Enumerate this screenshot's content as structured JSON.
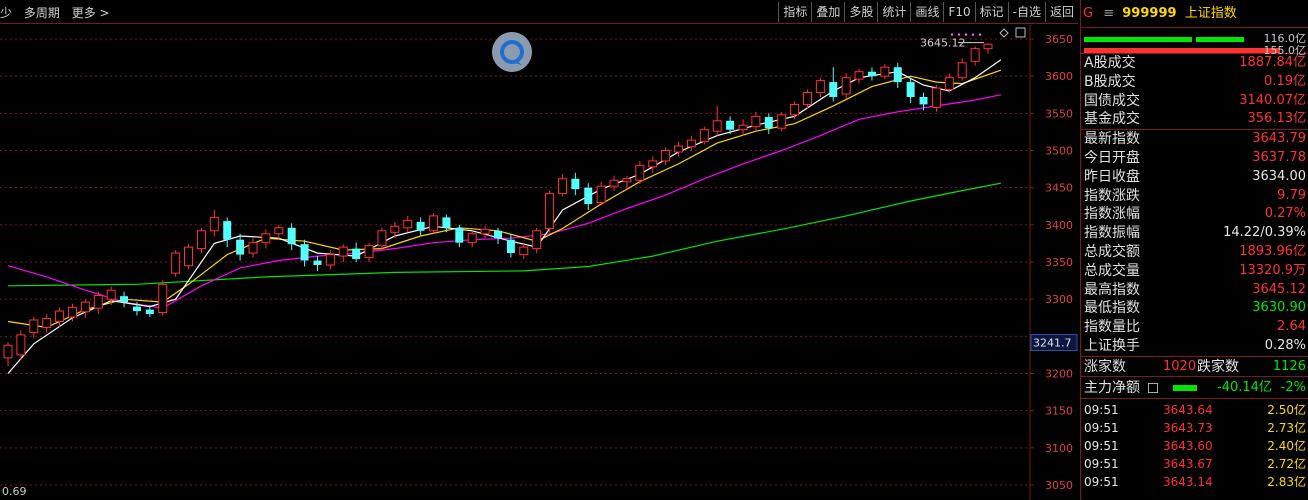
{
  "toolbar": {
    "left_items": [
      "少",
      "多周期",
      "更多 >"
    ],
    "buttons": [
      "指标",
      "叠加",
      "多股",
      "统计",
      "画线",
      "F10",
      "标记",
      "-自选",
      "返回"
    ]
  },
  "chart": {
    "price_axis": [
      "3650",
      "3600",
      "3550",
      "3500",
      "3450",
      "3400",
      "3350",
      "3300",
      "3241.7",
      "3200",
      "3150",
      "3100",
      "3050"
    ],
    "high_label": "3645.12",
    "bottom_left_value": "0.69",
    "colors": {
      "up": "#ff3232",
      "down": "#54ffff",
      "ma5": "#ffffff",
      "ma10": "#ffd800",
      "ma20": "#ff00ff",
      "ma60": "#00e600",
      "grid": "#7a1a1a"
    },
    "icon": "chat-bubble-icon"
  },
  "chart_data": {
    "type": "candlestick",
    "ylim": [
      3050,
      3660
    ],
    "candles": [
      [
        3221,
        3238,
        3210,
        3242
      ],
      [
        3225,
        3252,
        3218,
        3258
      ],
      [
        3255,
        3272,
        3248,
        3276
      ],
      [
        3262,
        3274,
        3255,
        3280
      ],
      [
        3270,
        3284,
        3262,
        3289
      ],
      [
        3276,
        3289,
        3270,
        3294
      ],
      [
        3283,
        3296,
        3275,
        3300
      ],
      [
        3288,
        3305,
        3280,
        3310
      ],
      [
        3300,
        3312,
        3292,
        3317
      ],
      [
        3304,
        3296,
        3289,
        3310
      ],
      [
        3290,
        3284,
        3278,
        3296
      ],
      [
        3286,
        3280,
        3276,
        3292
      ],
      [
        3282,
        3320,
        3278,
        3326
      ],
      [
        3335,
        3362,
        3330,
        3366
      ],
      [
        3345,
        3370,
        3340,
        3374
      ],
      [
        3368,
        3392,
        3362,
        3396
      ],
      [
        3392,
        3410,
        3385,
        3420
      ],
      [
        3405,
        3380,
        3370,
        3410
      ],
      [
        3380,
        3360,
        3352,
        3388
      ],
      [
        3362,
        3376,
        3356,
        3382
      ],
      [
        3376,
        3388,
        3368,
        3394
      ],
      [
        3388,
        3396,
        3380,
        3400
      ],
      [
        3396,
        3374,
        3366,
        3402
      ],
      [
        3374,
        3352,
        3344,
        3380
      ],
      [
        3352,
        3346,
        3338,
        3358
      ],
      [
        3346,
        3360,
        3340,
        3366
      ],
      [
        3358,
        3370,
        3350,
        3374
      ],
      [
        3368,
        3354,
        3350,
        3376
      ],
      [
        3356,
        3372,
        3350,
        3376
      ],
      [
        3372,
        3392,
        3366,
        3396
      ],
      [
        3390,
        3398,
        3382,
        3404
      ],
      [
        3396,
        3406,
        3390,
        3412
      ],
      [
        3404,
        3392,
        3386,
        3410
      ],
      [
        3392,
        3412,
        3388,
        3416
      ],
      [
        3410,
        3396,
        3390,
        3414
      ],
      [
        3396,
        3376,
        3370,
        3400
      ],
      [
        3376,
        3388,
        3370,
        3392
      ],
      [
        3388,
        3394,
        3382,
        3398
      ],
      [
        3392,
        3382,
        3374,
        3396
      ],
      [
        3380,
        3362,
        3356,
        3388
      ],
      [
        3360,
        3370,
        3354,
        3376
      ],
      [
        3368,
        3392,
        3362,
        3396
      ],
      [
        3395,
        3442,
        3390,
        3446
      ],
      [
        3442,
        3462,
        3438,
        3468
      ],
      [
        3462,
        3448,
        3440,
        3470
      ],
      [
        3450,
        3428,
        3420,
        3456
      ],
      [
        3430,
        3452,
        3426,
        3458
      ],
      [
        3452,
        3460,
        3446,
        3466
      ],
      [
        3458,
        3462,
        3450,
        3466
      ],
      [
        3460,
        3480,
        3455,
        3486
      ],
      [
        3478,
        3486,
        3470,
        3492
      ],
      [
        3486,
        3500,
        3480,
        3504
      ],
      [
        3498,
        3506,
        3492,
        3512
      ],
      [
        3505,
        3514,
        3500,
        3520
      ],
      [
        3512,
        3528,
        3508,
        3532
      ],
      [
        3526,
        3540,
        3520,
        3560
      ],
      [
        3540,
        3528,
        3522,
        3546
      ],
      [
        3528,
        3534,
        3520,
        3542
      ],
      [
        3532,
        3546,
        3526,
        3552
      ],
      [
        3545,
        3530,
        3522,
        3550
      ],
      [
        3530,
        3548,
        3526,
        3552
      ],
      [
        3548,
        3562,
        3542,
        3566
      ],
      [
        3562,
        3578,
        3556,
        3582
      ],
      [
        3578,
        3594,
        3572,
        3598
      ],
      [
        3592,
        3572,
        3566,
        3612
      ],
      [
        3576,
        3598,
        3570,
        3604
      ],
      [
        3596,
        3606,
        3590,
        3610
      ],
      [
        3606,
        3600,
        3594,
        3612
      ],
      [
        3600,
        3612,
        3596,
        3616
      ],
      [
        3612,
        3592,
        3584,
        3618
      ],
      [
        3592,
        3572,
        3564,
        3598
      ],
      [
        3572,
        3562,
        3554,
        3578
      ],
      [
        3558,
        3584,
        3552,
        3588
      ],
      [
        3582,
        3598,
        3578,
        3604
      ],
      [
        3598,
        3618,
        3594,
        3624
      ],
      [
        3620,
        3637,
        3614,
        3640
      ],
      [
        3637,
        3643,
        3630,
        3645
      ]
    ],
    "ma": {
      "ma5": {
        "color": "#ffffff",
        "points": [
          [
            0,
            3200
          ],
          [
            2,
            3240
          ],
          [
            5,
            3275
          ],
          [
            8,
            3298
          ],
          [
            11,
            3290
          ],
          [
            13,
            3300
          ],
          [
            16,
            3375
          ],
          [
            18,
            3385
          ],
          [
            21,
            3382
          ],
          [
            24,
            3362
          ],
          [
            27,
            3358
          ],
          [
            30,
            3385
          ],
          [
            33,
            3398
          ],
          [
            36,
            3392
          ],
          [
            39,
            3378
          ],
          [
            41,
            3370
          ],
          [
            43,
            3420
          ],
          [
            46,
            3448
          ],
          [
            49,
            3468
          ],
          [
            52,
            3498
          ],
          [
            55,
            3520
          ],
          [
            58,
            3534
          ],
          [
            61,
            3546
          ],
          [
            64,
            3580
          ],
          [
            66,
            3598
          ],
          [
            69,
            3606
          ],
          [
            71,
            3588
          ],
          [
            73,
            3580
          ],
          [
            75,
            3598
          ],
          [
            77,
            3622
          ]
        ]
      },
      "ma10": {
        "color": "#ffd800",
        "points": [
          [
            0,
            3270
          ],
          [
            3,
            3262
          ],
          [
            6,
            3286
          ],
          [
            9,
            3300
          ],
          [
            12,
            3296
          ],
          [
            14,
            3320
          ],
          [
            17,
            3360
          ],
          [
            20,
            3382
          ],
          [
            23,
            3378
          ],
          [
            26,
            3366
          ],
          [
            29,
            3368
          ],
          [
            32,
            3385
          ],
          [
            35,
            3396
          ],
          [
            38,
            3392
          ],
          [
            41,
            3378
          ],
          [
            43,
            3395
          ],
          [
            46,
            3428
          ],
          [
            49,
            3458
          ],
          [
            52,
            3482
          ],
          [
            55,
            3510
          ],
          [
            58,
            3526
          ],
          [
            61,
            3536
          ],
          [
            64,
            3560
          ],
          [
            67,
            3586
          ],
          [
            70,
            3600
          ],
          [
            72,
            3592
          ],
          [
            74,
            3590
          ],
          [
            77,
            3608
          ]
        ]
      },
      "ma20": {
        "color": "#ff00ff",
        "points": [
          [
            0,
            3345
          ],
          [
            3,
            3330
          ],
          [
            6,
            3312
          ],
          [
            9,
            3296
          ],
          [
            12,
            3288
          ],
          [
            15,
            3318
          ],
          [
            18,
            3342
          ],
          [
            21,
            3352
          ],
          [
            24,
            3358
          ],
          [
            27,
            3362
          ],
          [
            30,
            3368
          ],
          [
            33,
            3376
          ],
          [
            36,
            3380
          ],
          [
            39,
            3382
          ],
          [
            42,
            3388
          ],
          [
            45,
            3402
          ],
          [
            48,
            3422
          ],
          [
            51,
            3440
          ],
          [
            54,
            3462
          ],
          [
            57,
            3482
          ],
          [
            60,
            3500
          ],
          [
            63,
            3520
          ],
          [
            66,
            3542
          ],
          [
            69,
            3552
          ],
          [
            72,
            3560
          ],
          [
            75,
            3568
          ],
          [
            77,
            3575
          ]
        ]
      },
      "ma60": {
        "color": "#00e600",
        "points": [
          [
            0,
            3318
          ],
          [
            10,
            3320
          ],
          [
            20,
            3330
          ],
          [
            30,
            3336
          ],
          [
            40,
            3338
          ],
          [
            45,
            3344
          ],
          [
            50,
            3358
          ],
          [
            55,
            3378
          ],
          [
            60,
            3394
          ],
          [
            65,
            3412
          ],
          [
            70,
            3432
          ],
          [
            74,
            3446
          ],
          [
            77,
            3456
          ]
        ]
      }
    }
  },
  "panel": {
    "flag": "G",
    "menu_glyph": "≡",
    "code": "999999",
    "name": "上证指数",
    "bar_values": [
      "116.0亿",
      "155.0亿"
    ],
    "rows1": [
      {
        "label": "A股成交",
        "value": "1887.84亿",
        "color": "red"
      },
      {
        "label": "B股成交",
        "value": "0.19亿",
        "color": "red"
      },
      {
        "label": "国债成交",
        "value": "3140.07亿",
        "color": "red"
      },
      {
        "label": "基金成交",
        "value": "356.13亿",
        "color": "red"
      }
    ],
    "rows2": [
      {
        "label": "最新指数",
        "value": "3643.79",
        "color": "red"
      },
      {
        "label": "今日开盘",
        "value": "3637.78",
        "color": "red"
      },
      {
        "label": "昨日收盘",
        "value": "3634.00",
        "color": "white"
      },
      {
        "label": "指数涨跌",
        "value": "9.79",
        "color": "red"
      },
      {
        "label": "指数涨幅",
        "value": "0.27%",
        "color": "red"
      },
      {
        "label": "指数振幅",
        "value": "14.22/0.39%",
        "color": "white"
      },
      {
        "label": "总成交额",
        "value": "1893.96亿",
        "color": "red"
      },
      {
        "label": "总成交量",
        "value": "13320.9万",
        "color": "red"
      },
      {
        "label": "最高指数",
        "value": "3645.12",
        "color": "red"
      },
      {
        "label": "最低指数",
        "value": "3630.90",
        "color": "green"
      },
      {
        "label": "指数量比",
        "value": "2.64",
        "color": "red"
      },
      {
        "label": "上证换手",
        "value": "0.28%",
        "color": "white"
      }
    ],
    "updown": {
      "up_label": "涨家数",
      "up_value": "1020",
      "down_label": "跌家数",
      "down_value": "1126"
    },
    "mainflow": {
      "label": "主力净额",
      "value": "-40.14亿",
      "pct": "-2%"
    },
    "ticks": [
      {
        "time": "09:51",
        "price": "3643.64",
        "amount": "2.50亿"
      },
      {
        "time": "09:51",
        "price": "3643.73",
        "amount": "2.73亿"
      },
      {
        "time": "09:51",
        "price": "3643.60",
        "amount": "2.40亿"
      },
      {
        "time": "09:51",
        "price": "3643.67",
        "amount": "2.72亿"
      },
      {
        "time": "09:51",
        "price": "3643.14",
        "amount": "2.83亿"
      }
    ]
  }
}
